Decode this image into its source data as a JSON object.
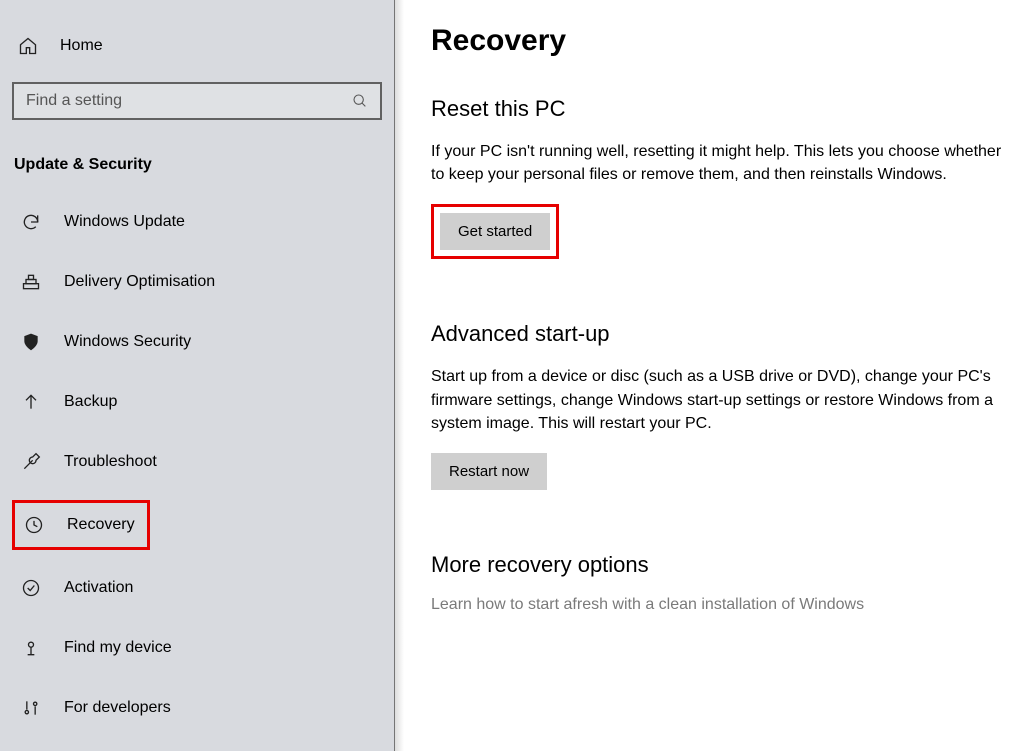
{
  "sidebar": {
    "home_label": "Home",
    "search_placeholder": "Find a setting",
    "section_title": "Update & Security",
    "items": [
      {
        "icon": "sync-icon",
        "label": "Windows Update"
      },
      {
        "icon": "delivery-icon",
        "label": "Delivery Optimisation"
      },
      {
        "icon": "shield-icon",
        "label": "Windows Security"
      },
      {
        "icon": "arrow-up-icon",
        "label": "Backup"
      },
      {
        "icon": "wrench-icon",
        "label": "Troubleshoot"
      },
      {
        "icon": "history-icon",
        "label": "Recovery"
      },
      {
        "icon": "check-circle-icon",
        "label": "Activation"
      },
      {
        "icon": "find-device-icon",
        "label": "Find my device"
      },
      {
        "icon": "developers-icon",
        "label": "For developers"
      }
    ]
  },
  "main": {
    "title": "Recovery",
    "reset": {
      "heading": "Reset this PC",
      "desc": "If your PC isn't running well, resetting it might help. This lets you choose whether to keep your personal files or remove them, and then reinstalls Windows.",
      "button": "Get started"
    },
    "advanced": {
      "heading": "Advanced start-up",
      "desc": "Start up from a device or disc (such as a USB drive or DVD), change your PC's firmware settings, change Windows start-up settings or restore Windows from a system image. This will restart your PC.",
      "button": "Restart now"
    },
    "more": {
      "heading": "More recovery options",
      "link": "Learn how to start afresh with a clean installation of Windows"
    }
  }
}
